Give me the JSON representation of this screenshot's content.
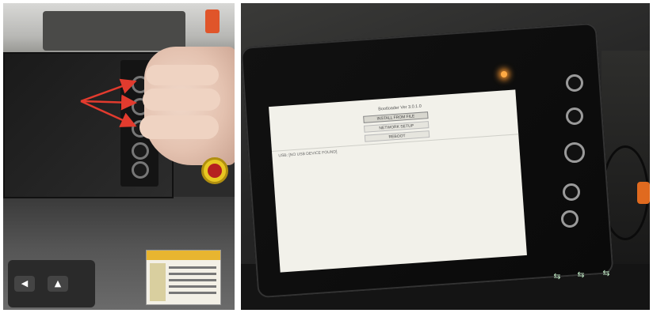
{
  "photos": {
    "left": {
      "keypad_keys": [
        "◀",
        "▲"
      ]
    },
    "right": {
      "screen": {
        "title": "Bootloader Ver 3.0.1.0",
        "menu": [
          {
            "label": "INSTALL FROM FILE",
            "selected": true
          },
          {
            "label": "NETWORK SETUP",
            "selected": false
          },
          {
            "label": "REBOOT",
            "selected": false
          }
        ],
        "status": "USB: [NO USB DEVICE FOUND]"
      }
    }
  },
  "colors": {
    "arrow": "#e23b2e",
    "estop": "#e8c722",
    "led": "#ffaa44"
  }
}
